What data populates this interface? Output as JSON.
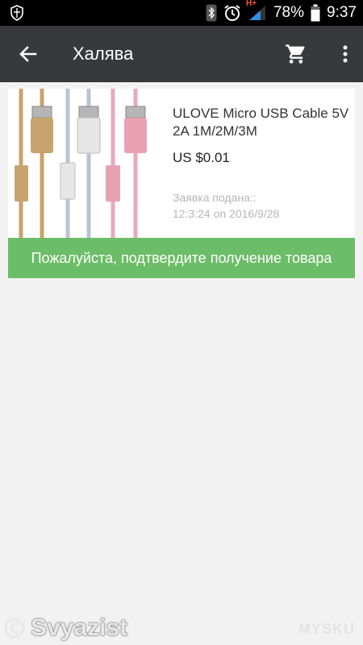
{
  "status_bar": {
    "battery": "78%",
    "time": "9:37",
    "network_type": "H+",
    "icons": [
      "shield-icon",
      "bluetooth-icon",
      "alarm-icon",
      "signal-icon",
      "battery-icon"
    ]
  },
  "app_bar": {
    "title": "Халява",
    "back_icon": "arrow-left-icon",
    "cart_icon": "cart-icon",
    "more_icon": "more-vertical-icon"
  },
  "order": {
    "product_name": "ULOVE Micro USB Cable 5V 2A 1M/2M/3M",
    "price": "US $0.01",
    "status_label": "Заявка подана::",
    "date": "12:3:24 on 2016/9/28",
    "confirm_button": "Пожалуйста, подтвердите получение товара",
    "cable_colors": [
      "#c9a36c",
      "#b9c3d6",
      "#e9a9b7"
    ]
  },
  "watermarks": {
    "left": "Svyazist",
    "right": "MYSKU"
  },
  "colors": {
    "app_bar": "#37393b",
    "confirm_button": "#6cbd67",
    "background": "#f2f2f2"
  }
}
